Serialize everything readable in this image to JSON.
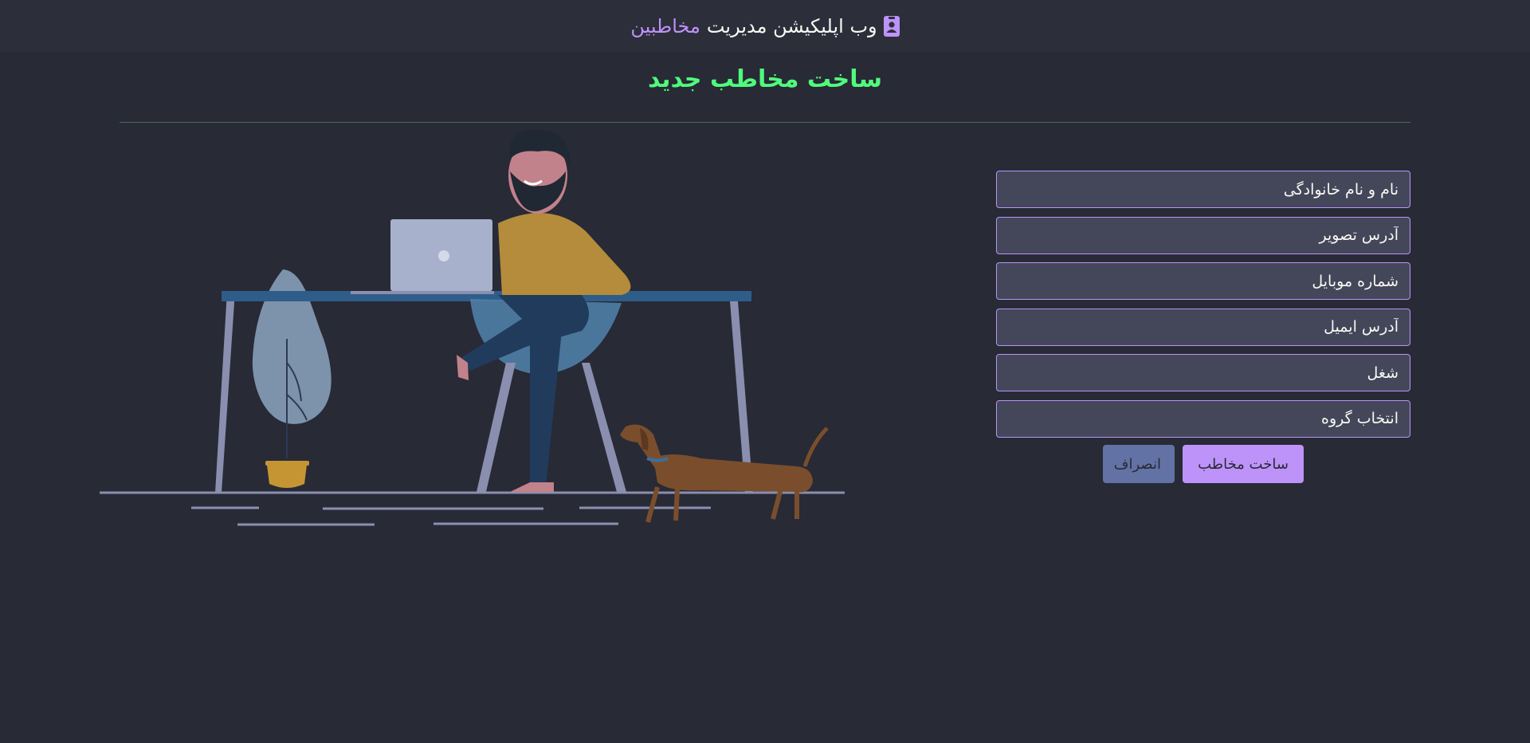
{
  "navbar": {
    "title_prefix": "وب اپلیکیشن مدیریت",
    "title_accent": "مخاطبین",
    "icon": "contact-card-icon"
  },
  "page": {
    "title": "ساخت مخاطب جدید"
  },
  "form": {
    "fullname_placeholder": "نام و نام خانوادگی",
    "photo_placeholder": "آدرس تصویر",
    "mobile_placeholder": "شماره موبایل",
    "email_placeholder": "آدرس ایمیل",
    "job_placeholder": "شغل",
    "group_select": "انتخاب گروه",
    "submit_label": "ساخت مخاطب",
    "cancel_label": "انصراف"
  },
  "colors": {
    "background": "#282a36",
    "navbar": "#2c2e3a",
    "purple": "#bd93f9",
    "green": "#50fa7b",
    "field": "#44475a",
    "comment": "#6272a4"
  }
}
